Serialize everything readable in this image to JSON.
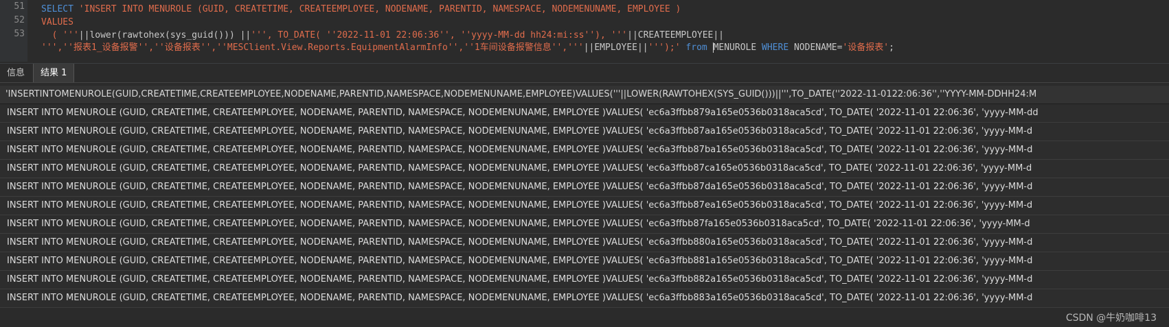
{
  "editor": {
    "line_numbers": [
      "51",
      "52",
      "53"
    ],
    "line1": {
      "kw": "SELECT ",
      "str": "'INSERT INTO MENUROLE (GUID, CREATETIME, CREATEEMPLOYEE, NODENAME, PARENTID, NAMESPACE, NODEMENUNAME, EMPLOYEE )"
    },
    "line2": {
      "str": "VALUES"
    },
    "line3": {
      "str_a": "  ( '''",
      "plain_a": "||lower(rawtohex(sys_guid())) ||",
      "str_b": "''', TO_DATE( ''2022-11-01 22:06:36'', ''yyyy-MM-dd hh24:mi:ss''), '''",
      "plain_b": "||CREATEEMPLOYEE||"
    },
    "line4": {
      "str_a": "''',''报表1_设备报警'',''设备报表'',''MESClient.View.Reports.EquipmentAlarmInfo'',''1车间设备报警信息'','''",
      "plain_a": "||EMPLOYEE||",
      "str_b": "''');' ",
      "kw_from": "from ",
      "plain_b": "MENUROLE ",
      "kw_where": "WHERE ",
      "plain_c": "NODENAME=",
      "str_c": "'设备报表'",
      "plain_d": ";"
    }
  },
  "tabs": {
    "info": "信息",
    "result": "结果 1"
  },
  "grid": {
    "header": "'INSERTINTOMENUROLE(GUID,CREATETIME,CREATEEMPLOYEE,NODENAME,PARENTID,NAMESPACE,NODEMENUNAME,EMPLOYEE)VALUES('''||LOWER(RAWTOHEX(SYS_GUID()))||''',TO_DATE(''2022-11-0122:06:36'',''YYYY-MM-DDHH24:M",
    "rows": [
      "INSERT INTO MENUROLE (GUID, CREATETIME, CREATEEMPLOYEE, NODENAME, PARENTID, NAMESPACE, NODEMENUNAME, EMPLOYEE )VALUES( 'ec6a3ffbb879a165e0536b0318aca5cd', TO_DATE( '2022-11-01 22:06:36', 'yyyy-MM-dd",
      "INSERT INTO MENUROLE (GUID, CREATETIME, CREATEEMPLOYEE, NODENAME, PARENTID, NAMESPACE, NODEMENUNAME, EMPLOYEE )VALUES( 'ec6a3ffbb87aa165e0536b0318aca5cd', TO_DATE( '2022-11-01 22:06:36', 'yyyy-MM-d",
      "INSERT INTO MENUROLE (GUID, CREATETIME, CREATEEMPLOYEE, NODENAME, PARENTID, NAMESPACE, NODEMENUNAME, EMPLOYEE )VALUES( 'ec6a3ffbb87ba165e0536b0318aca5cd', TO_DATE( '2022-11-01 22:06:36', 'yyyy-MM-d",
      "INSERT INTO MENUROLE (GUID, CREATETIME, CREATEEMPLOYEE, NODENAME, PARENTID, NAMESPACE, NODEMENUNAME, EMPLOYEE )VALUES( 'ec6a3ffbb87ca165e0536b0318aca5cd', TO_DATE( '2022-11-01 22:06:36', 'yyyy-MM-d",
      "INSERT INTO MENUROLE (GUID, CREATETIME, CREATEEMPLOYEE, NODENAME, PARENTID, NAMESPACE, NODEMENUNAME, EMPLOYEE )VALUES( 'ec6a3ffbb87da165e0536b0318aca5cd', TO_DATE( '2022-11-01 22:06:36', 'yyyy-MM-d",
      "INSERT INTO MENUROLE (GUID, CREATETIME, CREATEEMPLOYEE, NODENAME, PARENTID, NAMESPACE, NODEMENUNAME, EMPLOYEE )VALUES( 'ec6a3ffbb87ea165e0536b0318aca5cd', TO_DATE( '2022-11-01 22:06:36', 'yyyy-MM-d",
      "INSERT INTO MENUROLE (GUID, CREATETIME, CREATEEMPLOYEE, NODENAME, PARENTID, NAMESPACE, NODEMENUNAME, EMPLOYEE )VALUES( 'ec6a3ffbb87fa165e0536b0318aca5cd', TO_DATE( '2022-11-01 22:06:36', 'yyyy-MM-d",
      "INSERT INTO MENUROLE (GUID, CREATETIME, CREATEEMPLOYEE, NODENAME, PARENTID, NAMESPACE, NODEMENUNAME, EMPLOYEE )VALUES( 'ec6a3ffbb880a165e0536b0318aca5cd', TO_DATE( '2022-11-01 22:06:36', 'yyyy-MM-d",
      "INSERT INTO MENUROLE (GUID, CREATETIME, CREATEEMPLOYEE, NODENAME, PARENTID, NAMESPACE, NODEMENUNAME, EMPLOYEE )VALUES( 'ec6a3ffbb881a165e0536b0318aca5cd', TO_DATE( '2022-11-01 22:06:36', 'yyyy-MM-d",
      "INSERT INTO MENUROLE (GUID, CREATETIME, CREATEEMPLOYEE, NODENAME, PARENTID, NAMESPACE, NODEMENUNAME, EMPLOYEE )VALUES( 'ec6a3ffbb882a165e0536b0318aca5cd', TO_DATE( '2022-11-01 22:06:36', 'yyyy-MM-d",
      "INSERT INTO MENUROLE (GUID, CREATETIME, CREATEEMPLOYEE, NODENAME, PARENTID, NAMESPACE, NODEMENUNAME, EMPLOYEE )VALUES( 'ec6a3ffbb883a165e0536b0318aca5cd', TO_DATE( '2022-11-01 22:06:36', 'yyyy-MM-d"
    ]
  },
  "watermark": "CSDN @牛奶咖啡13",
  "colors": {
    "background": "#2b2b2b",
    "keyword": "#4f8fd6",
    "string": "#e06c4c",
    "text": "#dcdcdc"
  }
}
